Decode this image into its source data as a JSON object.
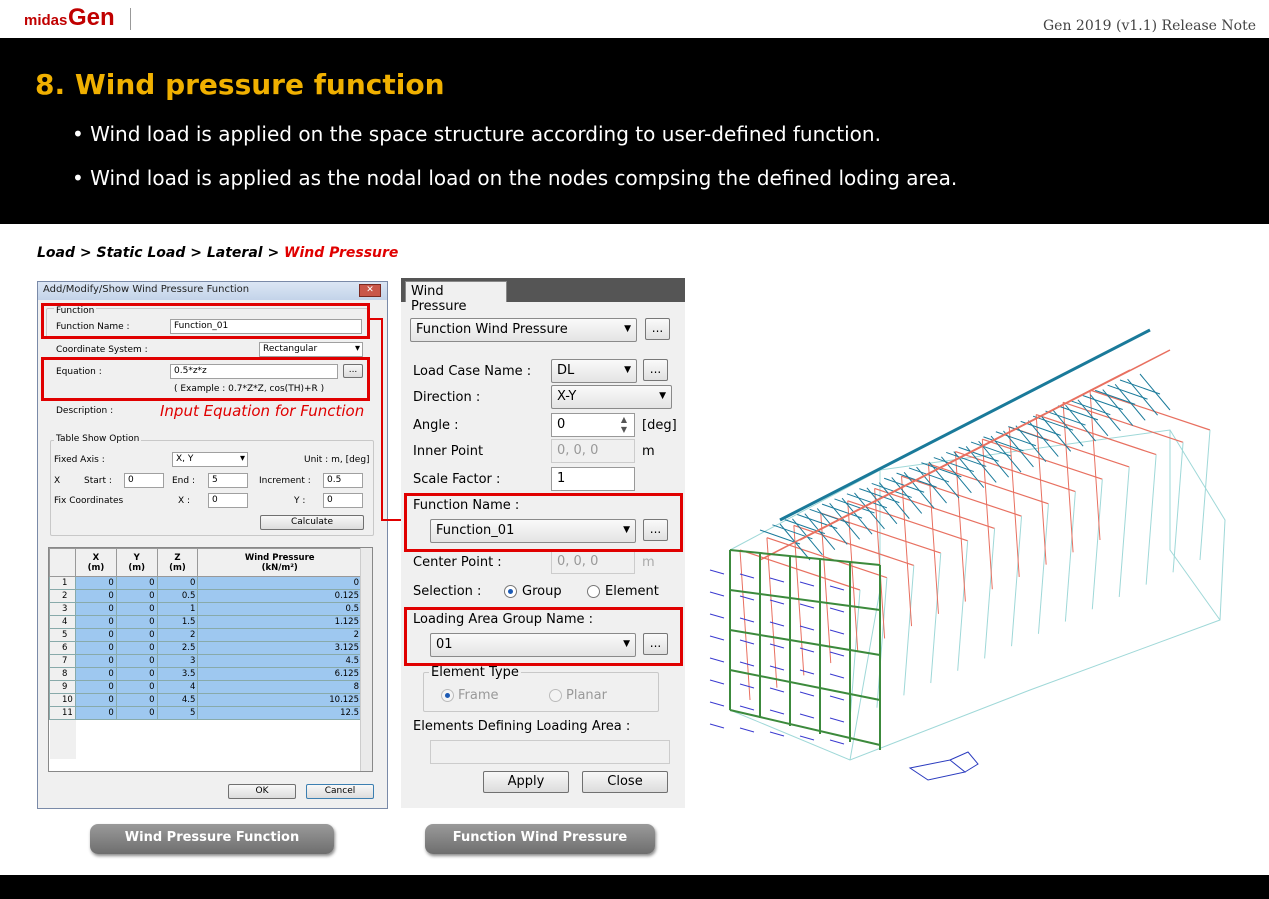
{
  "header": {
    "logo_midas": "midas",
    "logo_gen": "Gen",
    "release_note": "Gen 2019 (v1.1) Release Note"
  },
  "banner": {
    "title": "8. Wind pressure function",
    "bullets": [
      "• Wind load is applied on the space structure according to user-defined function.",
      "• Wind load is applied as the nodal load on the nodes compsing the defined loding area."
    ]
  },
  "breadcrumb": {
    "path": "Load > Static Load > Lateral > ",
    "current": "Wind Pressure"
  },
  "dialog1": {
    "title": "Add/Modify/Show Wind Pressure Function",
    "close": "✕",
    "function_group": "Function",
    "function_name_label": "Function Name :",
    "function_name_value": "Function_01",
    "coord_label": "Coordinate System :",
    "coord_value": "Rectangular",
    "equation_label": "Equation :",
    "equation_value": "0.5*z*z",
    "equation_example": "( Example : 0.7*Z*Z, cos(TH)+R )",
    "ellipsis": "...",
    "description_label": "Description :",
    "annotation": "Input Equation for Function",
    "table_show_group": "Table Show Option",
    "fixed_axis_label": "Fixed Axis :",
    "fixed_axis_value": "X, Y",
    "unit_label": "Unit : m, [deg]",
    "x_label": "X",
    "start_label": "Start :",
    "start_value": "0",
    "end_label": "End :",
    "end_value": "5",
    "increment_label": "Increment :",
    "increment_value": "0.5",
    "fix_coord_label": "Fix Coordinates",
    "fix_x_label": "X :",
    "fix_x_value": "0",
    "fix_y_label": "Y :",
    "fix_y_value": "0",
    "calculate": "Calculate",
    "table": {
      "headers": [
        "X\n(m)",
        "Y\n(m)",
        "Z\n(m)",
        "Wind Pressure\n(kN/m²)"
      ],
      "rows": [
        [
          "1",
          "0",
          "0",
          "0",
          "0"
        ],
        [
          "2",
          "0",
          "0",
          "0.5",
          "0.125"
        ],
        [
          "3",
          "0",
          "0",
          "1",
          "0.5"
        ],
        [
          "4",
          "0",
          "0",
          "1.5",
          "1.125"
        ],
        [
          "5",
          "0",
          "0",
          "2",
          "2"
        ],
        [
          "6",
          "0",
          "0",
          "2.5",
          "3.125"
        ],
        [
          "7",
          "0",
          "0",
          "3",
          "4.5"
        ],
        [
          "8",
          "0",
          "0",
          "3.5",
          "6.125"
        ],
        [
          "9",
          "0",
          "0",
          "4",
          "8"
        ],
        [
          "10",
          "0",
          "0",
          "4.5",
          "10.125"
        ],
        [
          "11",
          "0",
          "0",
          "5",
          "12.5"
        ]
      ]
    },
    "ok": "OK",
    "cancel": "Cancel"
  },
  "dialog2": {
    "tab": "Wind Pressure",
    "mode_value": "Function Wind Pressure",
    "load_case_label": "Load Case Name :",
    "load_case_value": "DL",
    "direction_label": "Direction :",
    "direction_value": "X-Y",
    "angle_label": "Angle :",
    "angle_value": "0",
    "angle_unit": "[deg]",
    "inner_point_label": "Inner Point",
    "inner_point_value": "0, 0, 0",
    "inner_point_unit": "m",
    "scale_label": "Scale Factor :",
    "scale_value": "1",
    "function_name_label": "Function Name :",
    "function_name_value": "Function_01",
    "center_point_label": "Center Point :",
    "center_point_value": "0, 0, 0",
    "center_point_unit": "m",
    "selection_label": "Selection :",
    "group_label": "Group",
    "element_label": "Element",
    "loading_area_label": "Loading Area Group Name :",
    "loading_area_value": "01",
    "element_type_label": "Element Type",
    "frame_label": "Frame",
    "planar_label": "Planar",
    "elements_def_label": "Elements Defining Loading Area :",
    "apply": "Apply",
    "close": "Close",
    "ellipsis": "..."
  },
  "pills": {
    "left": "Wind Pressure Function",
    "right": "Function Wind Pressure"
  },
  "colors": {
    "accent_title": "#f0b000",
    "red": "#e00000",
    "teal": "#1a7a9a",
    "salmon": "#e87060"
  }
}
